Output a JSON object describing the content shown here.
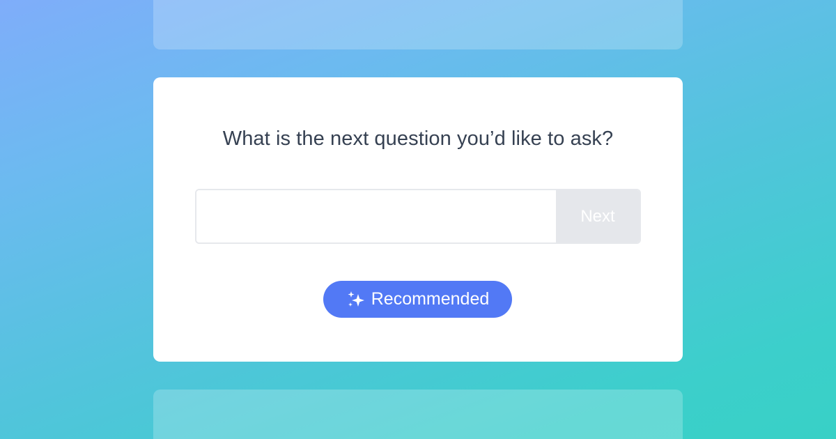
{
  "prompt": {
    "question": "What is the next question you’d like to ask?"
  },
  "answer_input": {
    "value": "",
    "placeholder": ""
  },
  "buttons": {
    "next_label": "Next",
    "recommended_label": "Recommended",
    "recommended_icon": "sparkle-icon"
  },
  "colors": {
    "accent": "#5279F5",
    "next_disabled_bg": "#E5E7EB",
    "question_text": "#364152"
  }
}
